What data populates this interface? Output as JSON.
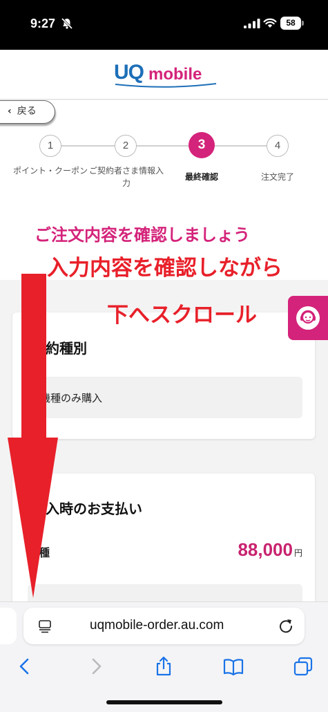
{
  "status_bar": {
    "time": "9:27",
    "battery": "58"
  },
  "header": {
    "logo_uq": "UQ",
    "logo_mobile": "mobile"
  },
  "nav": {
    "back_label": "戻る"
  },
  "steps": [
    {
      "number": "1",
      "label": "ポイント・クーポン",
      "state": "done"
    },
    {
      "number": "2",
      "label": "ご契約者さま情報入力",
      "state": "done"
    },
    {
      "number": "3",
      "label": "最終確認",
      "state": "current"
    },
    {
      "number": "4",
      "label": "注文完了",
      "state": "pending"
    }
  ],
  "annotations": {
    "line1": "ご注文内容を確認しましょう",
    "line2": "入力内容を確認しながら",
    "line3": "下へスクロール"
  },
  "contract": {
    "title": "契約種別",
    "value": "機種のみ購入"
  },
  "payment": {
    "title": "購入時のお支払い",
    "row_label": "種",
    "amount": "88,000",
    "unit": "円"
  },
  "browser": {
    "url": "uqmobile-order.au.com"
  },
  "colors": {
    "brand_pink": "#d4237a",
    "brand_blue": "#1d6fb8",
    "annotation_red": "#e8202a"
  }
}
